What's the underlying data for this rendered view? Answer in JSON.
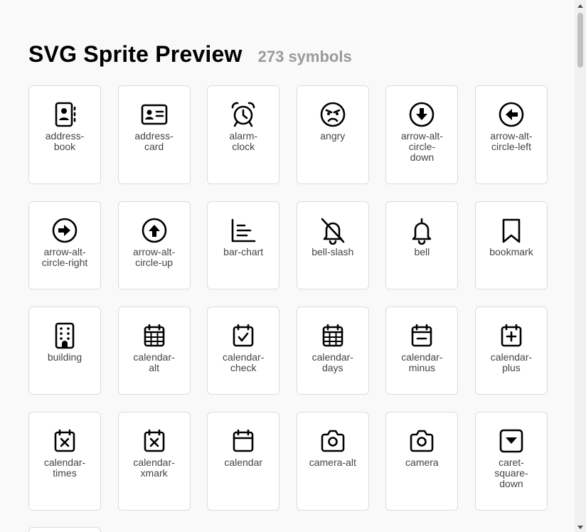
{
  "header": {
    "title": "SVG Sprite Preview",
    "count": "273 symbols"
  },
  "icons": [
    {
      "label": "address-\nbook",
      "icon": "address-book-icon"
    },
    {
      "label": "address-\ncard",
      "icon": "address-card-icon"
    },
    {
      "label": "alarm-\nclock",
      "icon": "alarm-clock-icon"
    },
    {
      "label": "angry",
      "icon": "angry-icon"
    },
    {
      "label": "arrow-alt-\ncircle-\ndown",
      "icon": "arrow-alt-circle-down-icon"
    },
    {
      "label": "arrow-alt-\ncircle-left",
      "icon": "arrow-alt-circle-left-icon"
    },
    {
      "label": "arrow-alt-\ncircle-right",
      "icon": "arrow-alt-circle-right-icon"
    },
    {
      "label": "arrow-alt-\ncircle-up",
      "icon": "arrow-alt-circle-up-icon"
    },
    {
      "label": "bar-chart",
      "icon": "bar-chart-icon"
    },
    {
      "label": "bell-slash",
      "icon": "bell-slash-icon"
    },
    {
      "label": "bell",
      "icon": "bell-icon"
    },
    {
      "label": "bookmark",
      "icon": "bookmark-icon"
    },
    {
      "label": "building",
      "icon": "building-icon"
    },
    {
      "label": "calendar-\nalt",
      "icon": "calendar-alt-icon"
    },
    {
      "label": "calendar-\ncheck",
      "icon": "calendar-check-icon"
    },
    {
      "label": "calendar-\ndays",
      "icon": "calendar-days-icon"
    },
    {
      "label": "calendar-\nminus",
      "icon": "calendar-minus-icon"
    },
    {
      "label": "calendar-\nplus",
      "icon": "calendar-plus-icon"
    },
    {
      "label": "calendar-\ntimes",
      "icon": "calendar-times-icon"
    },
    {
      "label": "calendar-\nxmark",
      "icon": "calendar-xmark-icon"
    },
    {
      "label": "calendar",
      "icon": "calendar-icon"
    },
    {
      "label": "camera-alt",
      "icon": "camera-alt-icon"
    },
    {
      "label": "camera",
      "icon": "camera-icon"
    },
    {
      "label": "caret-\nsquare-\ndown",
      "icon": "caret-square-down-icon"
    }
  ]
}
